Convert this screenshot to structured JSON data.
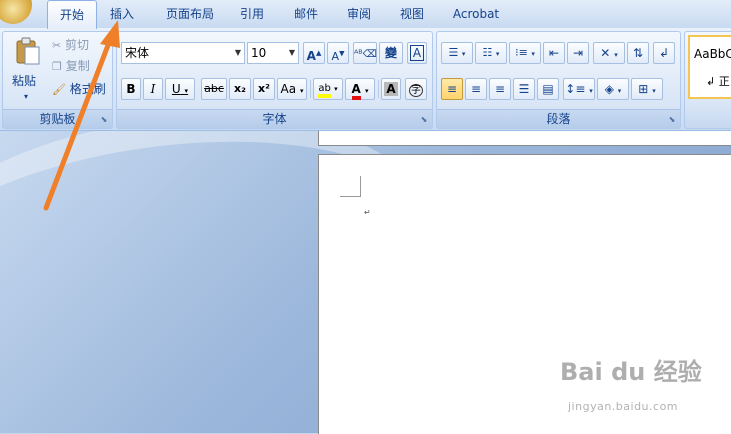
{
  "tabs": [
    "开始",
    "插入",
    "页面布局",
    "引用",
    "邮件",
    "审阅",
    "视图",
    "Acrobat"
  ],
  "clipboard": {
    "paste_label": "粘贴",
    "cut_label": "剪切",
    "copy_label": "复制",
    "format_painter_label": "格式刷",
    "group_label": "剪贴板"
  },
  "font": {
    "font_name": "宋体",
    "font_size": "10",
    "phonetic_label": "變",
    "group_label": "字体",
    "bold": "B",
    "italic": "I",
    "underline": "U",
    "strikethrough": "abc",
    "subscript": "x₂",
    "superscript": "x²",
    "change_case": "Aa",
    "highlight": "ab",
    "font_color": "A",
    "char_shading": "A",
    "enclose": "字"
  },
  "paragraph": {
    "group_label": "段落"
  },
  "styles": {
    "preview_text": "AaBbC",
    "normal_label": "↲ 正"
  },
  "watermark": {
    "brand": "Bai du 经验",
    "url": "jingyan.baidu.com"
  },
  "colors": {
    "highlight": "#ffff00",
    "font_color": "#e01010",
    "arrow": "#f07f2a"
  }
}
